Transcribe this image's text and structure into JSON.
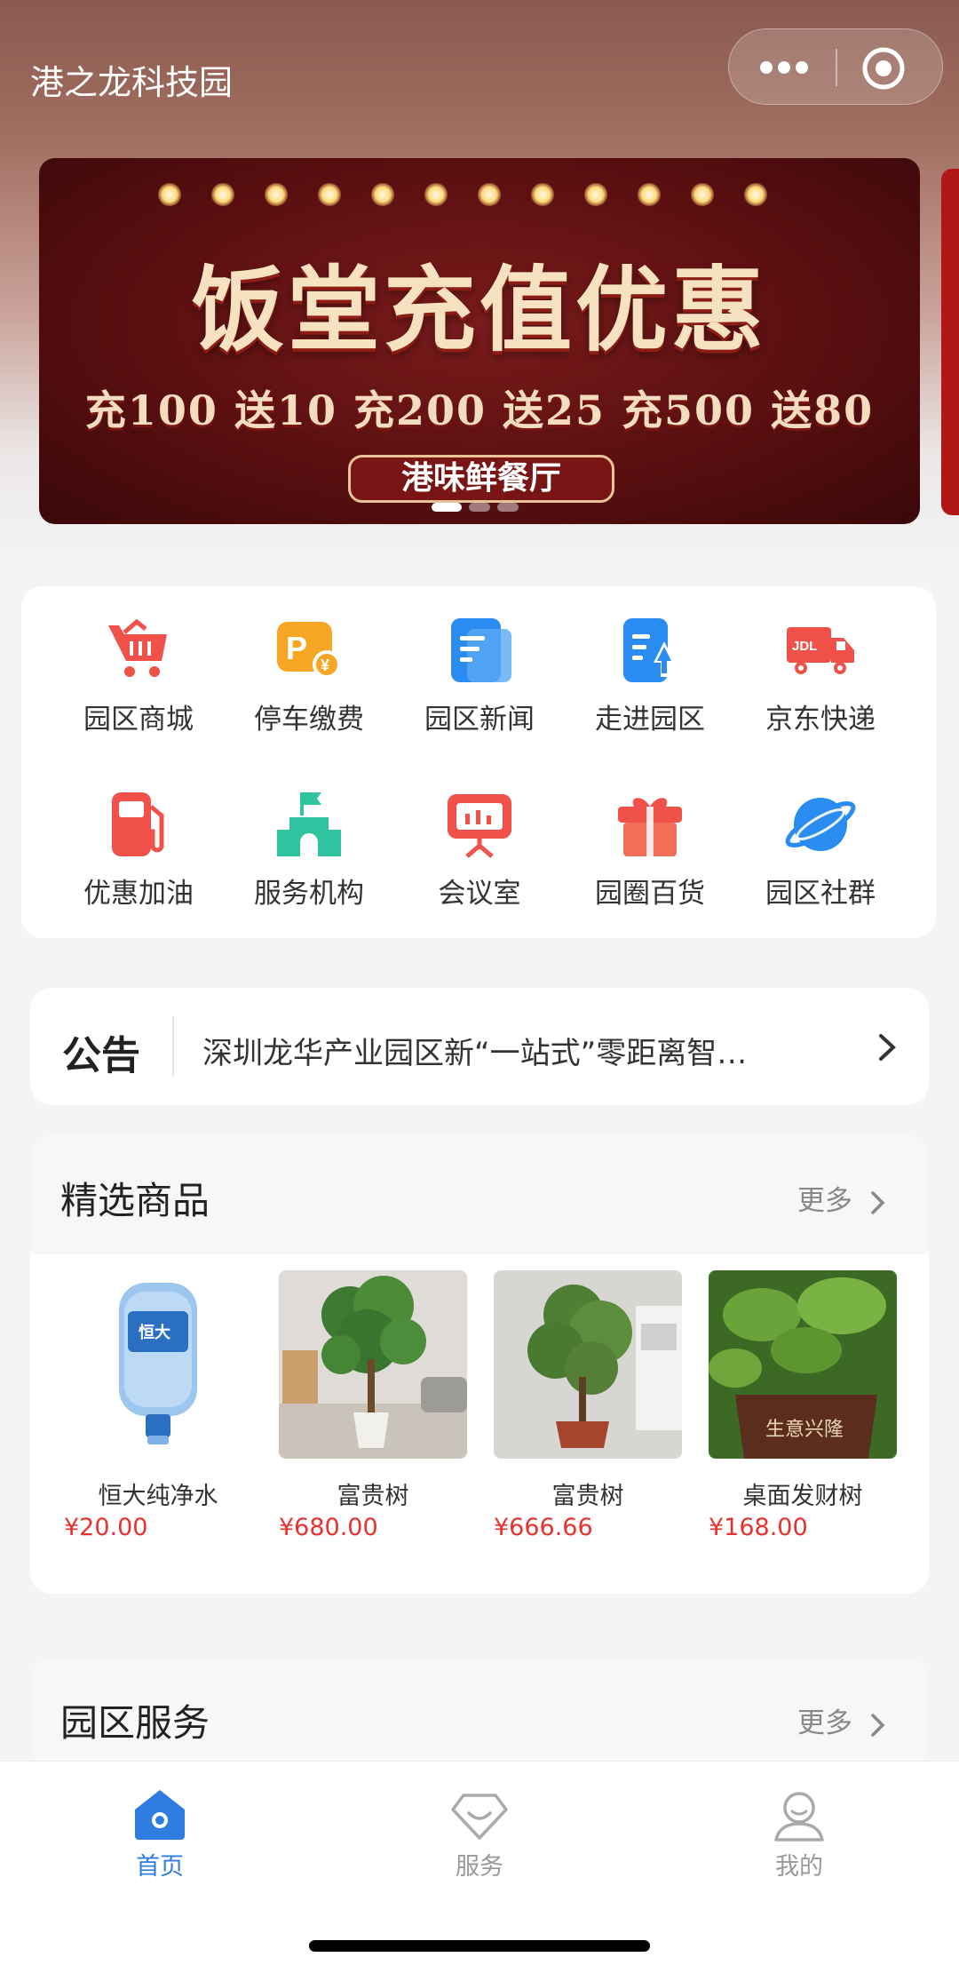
{
  "header": {
    "title": "港之龙科技园",
    "more_icon": "more-dots-icon",
    "close_icon": "target-circle-icon"
  },
  "banner": {
    "title": "饭堂充值优惠",
    "promo": "充100 送10  充200 送25  充500 送80",
    "tag": "港味鲜餐厅",
    "slides": 3,
    "active_slide": 1
  },
  "grid": {
    "items": [
      {
        "label": "园区商城",
        "icon": "shopping-cart-icon",
        "color": "#f0524a"
      },
      {
        "label": "停车缴费",
        "icon": "parking-payment-icon",
        "color": "#f7a623"
      },
      {
        "label": "园区新闻",
        "icon": "news-document-icon",
        "color": "#2a8cf0"
      },
      {
        "label": "走进园区",
        "icon": "park-guide-icon",
        "color": "#2a8cf0"
      },
      {
        "label": "京东快递",
        "icon": "delivery-truck-icon",
        "color": "#f0524a"
      },
      {
        "label": "优惠加油",
        "icon": "fuel-pump-icon",
        "color": "#f0524a"
      },
      {
        "label": "服务机构",
        "icon": "building-flag-icon",
        "color": "#2fc3a0"
      },
      {
        "label": "会议室",
        "icon": "presentation-board-icon",
        "color": "#f0524a"
      },
      {
        "label": "园圈百货",
        "icon": "gift-box-icon",
        "color": "#f0524a"
      },
      {
        "label": "园区社群",
        "icon": "planet-icon",
        "color": "#2a8cf0"
      }
    ]
  },
  "notice": {
    "title": "公告",
    "text": "深圳龙华产业园区新“一站式”零距离智…"
  },
  "goods": {
    "title": "精选商品",
    "more": "更多",
    "items": [
      {
        "name": "恒大纯净水",
        "price": "¥20.00"
      },
      {
        "name": "富贵树",
        "price": "¥680.00"
      },
      {
        "name": "富贵树",
        "price": "¥666.66"
      },
      {
        "name": "桌面发财树",
        "price": "¥168.00"
      }
    ]
  },
  "services": {
    "title": "园区服务",
    "more": "更多"
  },
  "tabbar": {
    "tabs": [
      {
        "label": "首页",
        "icon": "home-icon",
        "active": true
      },
      {
        "label": "服务",
        "icon": "diamond-service-icon",
        "active": false
      },
      {
        "label": "我的",
        "icon": "user-profile-icon",
        "active": false
      }
    ]
  },
  "colors": {
    "accent": "#2f7de1",
    "price": "#e8322e"
  }
}
